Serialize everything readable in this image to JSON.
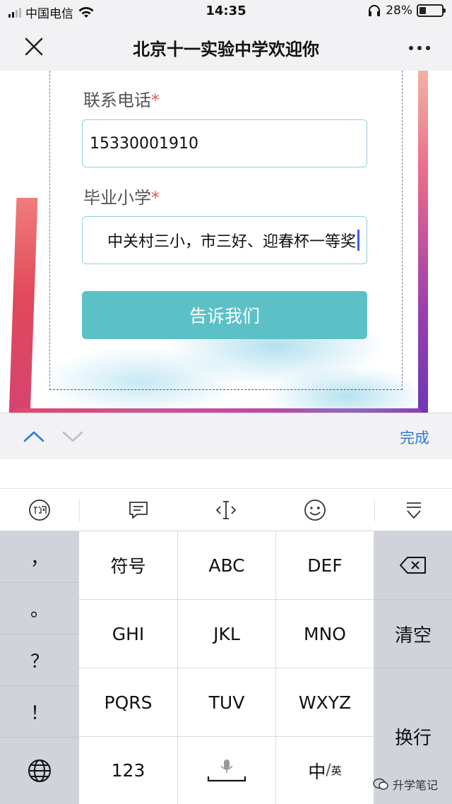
{
  "status_bar": {
    "carrier": "中国电信",
    "time": "14:35",
    "battery": "28%"
  },
  "nav": {
    "title": "北京十一实验中学欢迎你"
  },
  "form": {
    "phone_label": "联系电话",
    "phone_required": "*",
    "phone_value": "15330001910",
    "school_label": "毕业小学",
    "school_required": "*",
    "school_value": "中关村三小，市三好、迎春杯一等奖",
    "submit_label": "告诉我们"
  },
  "accessory": {
    "done_label": "完成"
  },
  "keyboard": {
    "side_left": [
      "，",
      "。",
      "？",
      "！"
    ],
    "rows": [
      [
        "符号",
        "ABC",
        "DEF"
      ],
      [
        "GHI",
        "JKL",
        "MNO"
      ],
      [
        "PQRS",
        "TUV",
        "WXYZ"
      ]
    ],
    "bottom": {
      "num": "123",
      "lang_main": "中",
      "lang_sub": "英"
    },
    "side_right": {
      "clear": "清空",
      "newline": "换行"
    }
  },
  "watermark": {
    "text": "升学笔记"
  },
  "colors": {
    "accent_teal": "#5bc1c6",
    "link_blue": "#2f7bd8",
    "required_red": "#e55555",
    "key_gray": "#d0d3d9"
  }
}
